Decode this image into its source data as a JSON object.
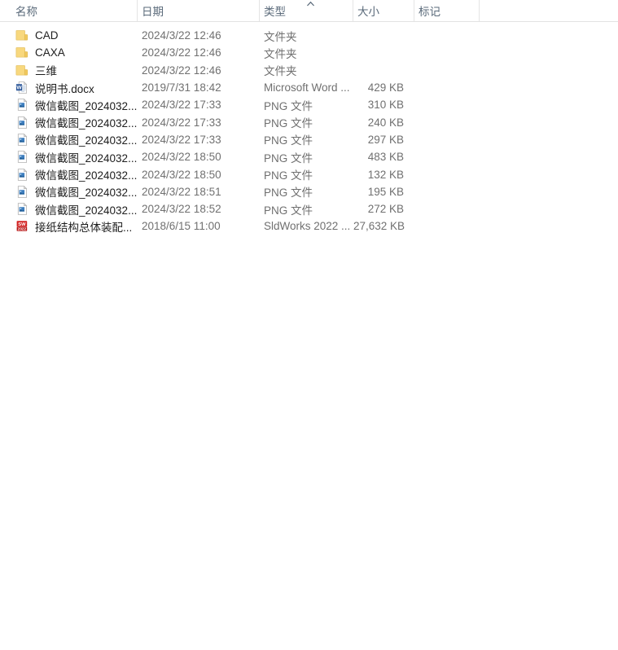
{
  "window": {
    "view_mode": "details-list"
  },
  "columns": [
    {
      "key": "name",
      "label": "名称",
      "sorted": false
    },
    {
      "key": "date",
      "label": "日期",
      "sorted": false
    },
    {
      "key": "type",
      "label": "类型",
      "sorted": true,
      "sort_direction": "ascending",
      "sort_icon": "caret-up-icon"
    },
    {
      "key": "size",
      "label": "大小",
      "sorted": false
    },
    {
      "key": "tags",
      "label": "标记",
      "sorted": false
    }
  ],
  "files": [
    {
      "icon": "folder-icon",
      "name": "CAD",
      "date": "2024/3/22 12:46",
      "type": "文件夹",
      "size": ""
    },
    {
      "icon": "folder-icon",
      "name": "CAXA",
      "date": "2024/3/22 12:46",
      "type": "文件夹",
      "size": ""
    },
    {
      "icon": "folder-icon",
      "name": "三维",
      "date": "2024/3/22 12:46",
      "type": "文件夹",
      "size": ""
    },
    {
      "icon": "word-doc-icon",
      "name": "说明书.docx",
      "date": "2019/7/31 18:42",
      "type": "Microsoft Word ...",
      "size": "429 KB"
    },
    {
      "icon": "png-image-icon",
      "name": "微信截图_2024032...",
      "date": "2024/3/22 17:33",
      "type": "PNG 文件",
      "size": "310 KB"
    },
    {
      "icon": "png-image-icon",
      "name": "微信截图_2024032...",
      "date": "2024/3/22 17:33",
      "type": "PNG 文件",
      "size": "240 KB"
    },
    {
      "icon": "png-image-icon",
      "name": "微信截图_2024032...",
      "date": "2024/3/22 17:33",
      "type": "PNG 文件",
      "size": "297 KB"
    },
    {
      "icon": "png-image-icon",
      "name": "微信截图_2024032...",
      "date": "2024/3/22 18:50",
      "type": "PNG 文件",
      "size": "483 KB"
    },
    {
      "icon": "png-image-icon",
      "name": "微信截图_2024032...",
      "date": "2024/3/22 18:50",
      "type": "PNG 文件",
      "size": "132 KB"
    },
    {
      "icon": "png-image-icon",
      "name": "微信截图_2024032...",
      "date": "2024/3/22 18:51",
      "type": "PNG 文件",
      "size": "195 KB"
    },
    {
      "icon": "png-image-icon",
      "name": "微信截图_2024032...",
      "date": "2024/3/22 18:52",
      "type": "PNG 文件",
      "size": "272 KB"
    },
    {
      "icon": "solidworks-icon",
      "name": "接纸结构总体装配...",
      "date": "2018/6/15 11:00",
      "type": "SldWorks 2022 ...",
      "size": "27,632 KB"
    }
  ],
  "colors": {
    "background": "#ffffff",
    "header_text": "#5a6a7a",
    "filename_text": "#1d1d1d",
    "meta_text": "#707070",
    "rule": "#e4e4e4",
    "folder_fill": "#f7d77f",
    "folder_edge": "#e8c46a",
    "word_blue": "#2b579a",
    "png_blue": "#3f7fbf",
    "solidworks_red": "#d32222"
  }
}
